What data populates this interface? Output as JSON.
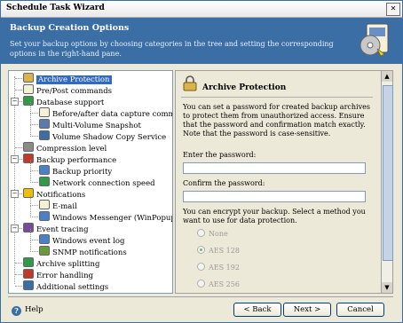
{
  "window": {
    "title": "Schedule Task Wizard",
    "close_glyph": "✕"
  },
  "header": {
    "title": "Backup Creation Options",
    "description": "Set your backup options by choosing categories in the tree and setting the corresponding options in the right-hand pane.",
    "icon": "backup-wizard-icon"
  },
  "tree": {
    "items": [
      {
        "label": "Archive Protection",
        "selected": true,
        "icon": "lock-icon"
      },
      {
        "label": "Pre/Post commands",
        "icon": "page-icon"
      },
      {
        "label": "Database support",
        "icon": "database-icon"
      },
      {
        "label": "Before/after data capture commands",
        "icon": "page-icon"
      },
      {
        "label": "Multi-Volume Snapshot",
        "icon": "snapshot-icon"
      },
      {
        "label": "Volume Shadow Copy Service",
        "icon": "vss-icon"
      },
      {
        "label": "Compression level",
        "icon": "compress-icon"
      },
      {
        "label": "Backup performance",
        "icon": "performance-icon"
      },
      {
        "label": "Backup priority",
        "icon": "priority-icon"
      },
      {
        "label": "Network connection speed",
        "icon": "network-icon"
      },
      {
        "label": "Notifications",
        "icon": "bulb-icon"
      },
      {
        "label": "E-mail",
        "icon": "email-icon"
      },
      {
        "label": "Windows Messenger (WinPopup)",
        "icon": "messenger-icon"
      },
      {
        "label": "Event tracing",
        "icon": "event-icon"
      },
      {
        "label": "Windows event log",
        "icon": "log-icon"
      },
      {
        "label": "SNMP notifications",
        "icon": "snmp-icon"
      },
      {
        "label": "Archive splitting",
        "icon": "split-icon"
      },
      {
        "label": "Error handling",
        "icon": "error-icon"
      },
      {
        "label": "Additional settings",
        "icon": "settings-icon"
      }
    ]
  },
  "panel": {
    "title": "Archive Protection",
    "intro": "You can set a password for created backup archives to protect them from unauthorized access. Ensure that the password and confirmation match exactly. Note that the password is case-sensitive.",
    "password_label": "Enter the password:",
    "password_value": "",
    "confirm_label": "Confirm the password:",
    "confirm_value": "",
    "encrypt_text": "You can encrypt your backup. Select a method you want to use for data protection.",
    "methods": [
      {
        "label": "None",
        "selected": false
      },
      {
        "label": "AES 128",
        "selected": true
      },
      {
        "label": "AES 192",
        "selected": false
      },
      {
        "label": "AES 256",
        "selected": false
      }
    ]
  },
  "footer": {
    "help_label": "Help",
    "back_label": "< Back",
    "next_label": "Next >",
    "cancel_label": "Cancel"
  },
  "colors": {
    "header_bg": "#3a6ea5",
    "selection": "#316ac5"
  }
}
